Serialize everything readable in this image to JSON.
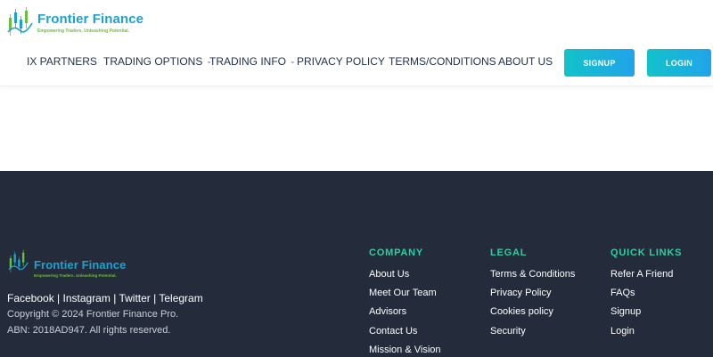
{
  "brand": {
    "name": "Frontier Finance",
    "tagline": "Empowering Traders. Unleashing Potential."
  },
  "nav": {
    "items": [
      {
        "label": "IX PARTNERS"
      },
      {
        "label": "TRADING OPTIONS",
        "dropdown": true
      },
      {
        "label": "TRADING INFO",
        "dropdown": true
      },
      {
        "label": "PRIVACY POLICY"
      },
      {
        "label": "TERMS/CONDITIONS"
      },
      {
        "label": "ABOUT US"
      }
    ],
    "signup_label": "SIGNUP",
    "login_label": "LOGIN"
  },
  "footer": {
    "social": {
      "facebook": "Facebook",
      "instagram": "Instagram",
      "twitter": "Twitter",
      "telegram": "Telegram",
      "separator": "|"
    },
    "copyright": "Copyright © 2024 Frontier Finance Pro.",
    "abn": "ABN: 2018AD947. All rights reserved.",
    "company": {
      "title": "COMPANY",
      "links": [
        "About Us",
        "Meet Our Team",
        "Advisors",
        "Contact Us",
        "Mission & Vision"
      ]
    },
    "legal": {
      "title": "LEGAL",
      "links": [
        "Terms & Conditions",
        "Privacy Policy",
        "Cookies policy",
        "Security"
      ]
    },
    "quick_links": {
      "title": "QUICK LINKS",
      "links": [
        "Refer A Friend",
        "FAQs",
        "Signup",
        "Login"
      ]
    }
  },
  "colors": {
    "brand_blue": "#1ba3cf",
    "brand_green": "#6cbf3c",
    "footer_bg": "#242b3b",
    "footer_heading": "#2ecfa3",
    "button_gradient_start": "#12c3c9",
    "button_gradient_end": "#21a3ea"
  }
}
